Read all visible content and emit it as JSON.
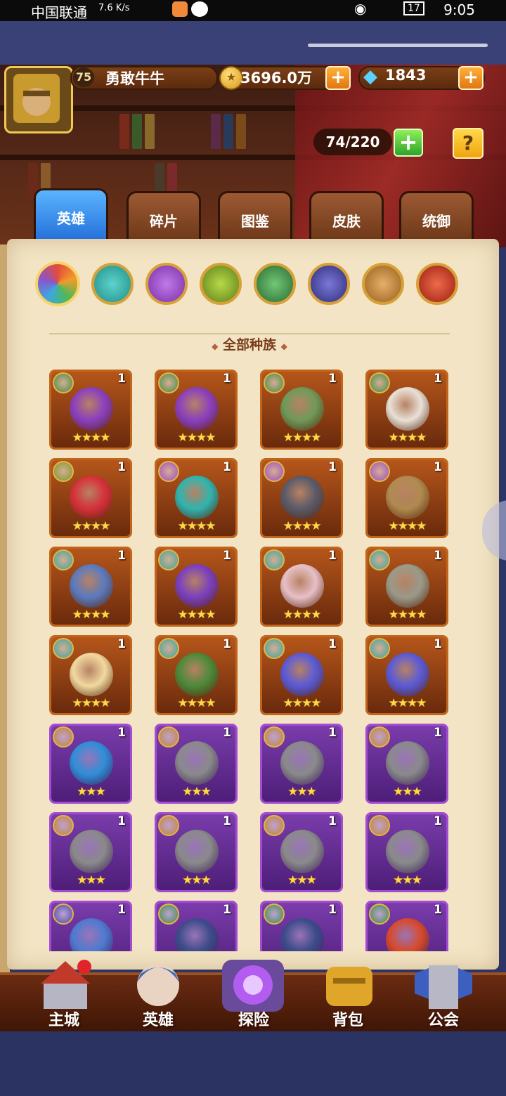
{
  "status_bar": {
    "carrier": "中国联通",
    "net_speed": "7.6 K/s",
    "battery": "17",
    "time": "9:05"
  },
  "player": {
    "level": "75",
    "name": "勇敢牛牛",
    "gold": "3696.0万",
    "gems": "1843"
  },
  "hero_count": "74/220",
  "tabs": [
    {
      "label": "英雄",
      "active": true
    },
    {
      "label": "碎片",
      "active": false
    },
    {
      "label": "图鉴",
      "active": false
    },
    {
      "label": "皮肤",
      "active": false
    },
    {
      "label": "统御",
      "active": false
    }
  ],
  "race_filters": [
    {
      "name": "all-races",
      "color": "#e34b3d",
      "selected": true
    },
    {
      "name": "race-1",
      "color": "#36a7a0"
    },
    {
      "name": "race-2",
      "color": "#9b4fc2"
    },
    {
      "name": "race-3",
      "color": "#7a9a2a"
    },
    {
      "name": "race-4",
      "color": "#3f8f45"
    },
    {
      "name": "race-5",
      "color": "#4d4ba3"
    },
    {
      "name": "race-6",
      "color": "#c4852d"
    },
    {
      "name": "race-7",
      "color": "#c63a2a"
    }
  ],
  "section_title": "全部种族",
  "heroes": [
    {
      "count": "1",
      "stars": "★★★★",
      "frame": "orange",
      "badge": "#3f8f45",
      "color": "#8b3fbf"
    },
    {
      "count": "1",
      "stars": "★★★★",
      "frame": "orange",
      "badge": "#3f8f45",
      "color": "#8b3fbf"
    },
    {
      "count": "1",
      "stars": "★★★★",
      "frame": "orange",
      "badge": "#3f8f45",
      "color": "#6f9a5a"
    },
    {
      "count": "1",
      "stars": "★★★★",
      "frame": "orange",
      "badge": "#3f8f45",
      "color": "#e8e1d8"
    },
    {
      "count": "1",
      "stars": "★★★★",
      "frame": "orange",
      "badge": "#7a9a2a",
      "color": "#d6303a"
    },
    {
      "count": "1",
      "stars": "★★★★",
      "frame": "orange",
      "badge": "#9b4fc2",
      "color": "#2fb5b0"
    },
    {
      "count": "1",
      "stars": "★★★★",
      "frame": "orange",
      "badge": "#9b4fc2",
      "color": "#5a5a6a"
    },
    {
      "count": "1",
      "stars": "★★★★",
      "frame": "orange",
      "badge": "#9b4fc2",
      "color": "#b08a50"
    },
    {
      "count": "1",
      "stars": "★★★★",
      "frame": "orange",
      "badge": "#36a7a0",
      "color": "#5a7abf"
    },
    {
      "count": "1",
      "stars": "★★★★",
      "frame": "orange",
      "badge": "#36a7a0",
      "color": "#7a3fbf"
    },
    {
      "count": "1",
      "stars": "★★★★",
      "frame": "orange",
      "badge": "#36a7a0",
      "color": "#e7c0c8"
    },
    {
      "count": "1",
      "stars": "★★★★",
      "frame": "orange",
      "badge": "#36a7a0",
      "color": "#9a9a8a"
    },
    {
      "count": "1",
      "stars": "★★★★",
      "frame": "orange",
      "badge": "#36a7a0",
      "color": "#f1d9a0"
    },
    {
      "count": "1",
      "stars": "★★★★",
      "frame": "orange",
      "badge": "#36a7a0",
      "color": "#4c8a3a"
    },
    {
      "count": "1",
      "stars": "★★★★",
      "frame": "orange",
      "badge": "#36a7a0",
      "color": "#5a5ad8"
    },
    {
      "count": "1",
      "stars": "★★★★",
      "frame": "orange",
      "badge": "#36a7a0",
      "color": "#5a5ad8"
    },
    {
      "count": "1",
      "stars": "★★★",
      "frame": "purple",
      "badge": "#c4852d",
      "color": "#2f8fd8"
    },
    {
      "count": "1",
      "stars": "★★★",
      "frame": "purple",
      "badge": "#c4852d",
      "color": "#8a8a8a"
    },
    {
      "count": "1",
      "stars": "★★★",
      "frame": "purple",
      "badge": "#c4852d",
      "color": "#8a8a8a"
    },
    {
      "count": "1",
      "stars": "★★★",
      "frame": "purple",
      "badge": "#c4852d",
      "color": "#8a8a8a"
    },
    {
      "count": "1",
      "stars": "★★★",
      "frame": "purple",
      "badge": "#c4852d",
      "color": "#8a8a8a"
    },
    {
      "count": "1",
      "stars": "★★★",
      "frame": "purple",
      "badge": "#c4852d",
      "color": "#8a8a8a"
    },
    {
      "count": "1",
      "stars": "★★★",
      "frame": "purple",
      "badge": "#c4852d",
      "color": "#8a8a8a"
    },
    {
      "count": "1",
      "stars": "★★★",
      "frame": "purple",
      "badge": "#c4852d",
      "color": "#8a8a8a"
    },
    {
      "count": "1",
      "stars": "",
      "frame": "purple",
      "badge": "#4d4ba3",
      "color": "#4f7ad0"
    },
    {
      "count": "1",
      "stars": "",
      "frame": "purple",
      "badge": "#3f8f45",
      "color": "#3d4c8a"
    },
    {
      "count": "1",
      "stars": "",
      "frame": "purple",
      "badge": "#3f8f45",
      "color": "#3d4c8a"
    },
    {
      "count": "1",
      "stars": "",
      "frame": "purple",
      "badge": "#3f8f45",
      "color": "#d84a2a"
    }
  ],
  "nav": [
    {
      "label": "主城",
      "icon": "castle-icon"
    },
    {
      "label": "英雄",
      "icon": "hero-portrait-icon"
    },
    {
      "label": "探险",
      "icon": "portal-icon"
    },
    {
      "label": "背包",
      "icon": "backpack-icon"
    },
    {
      "label": "公会",
      "icon": "guild-tower-icon"
    }
  ]
}
